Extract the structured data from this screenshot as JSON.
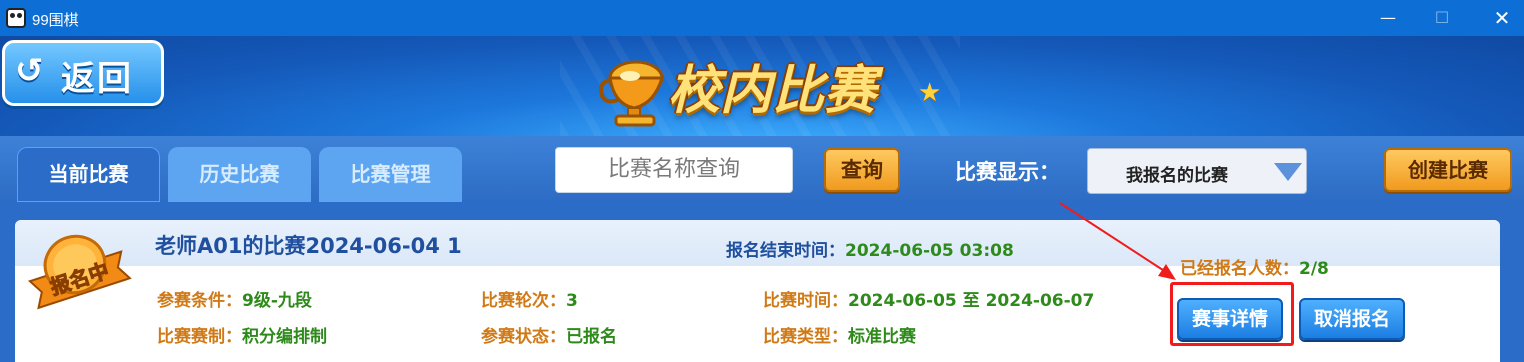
{
  "window": {
    "title": "99围棋",
    "minimize": "—",
    "maximize": "☐",
    "close": "✕"
  },
  "header": {
    "back_label": "返回",
    "back_arrow": "↺",
    "banner_title": "校内比赛",
    "star": "★"
  },
  "tabs": [
    {
      "label": "当前比赛",
      "active": true
    },
    {
      "label": "历史比赛",
      "active": false
    },
    {
      "label": "比赛管理",
      "active": false
    }
  ],
  "search": {
    "placeholder": "比赛名称查询",
    "button": "查询"
  },
  "filter": {
    "label": "比赛显示：",
    "selected": "我报名的比赛"
  },
  "create_button": "创建比赛",
  "match": {
    "badge": "报名中",
    "title": "老师A01的比赛2024-06-04 1",
    "signup_end_key": "报名结束时间：",
    "signup_end_val": "2024-06-05 03:08",
    "signup_count_key": "已经报名人数：",
    "signup_count_val": "2/8",
    "condition_key": "参赛条件：",
    "condition_val": "9级-九段",
    "rounds_key": "比赛轮次：",
    "rounds_val": "3",
    "period_key": "比赛时间：",
    "period_val": "2024-06-05 至 2024-06-07",
    "system_key": "比赛赛制：",
    "system_val": "积分编排制",
    "status_key": "参赛状态：",
    "status_val": "已报名",
    "type_key": "比赛类型：",
    "type_val": "标准比赛",
    "details_button": "赛事详情",
    "cancel_button": "取消报名"
  },
  "colors": {
    "accent_orange": "#d07a17",
    "value_green": "#2e8a1a",
    "title_blue": "#1f4f9e",
    "highlight_red": "#f21b1b"
  }
}
